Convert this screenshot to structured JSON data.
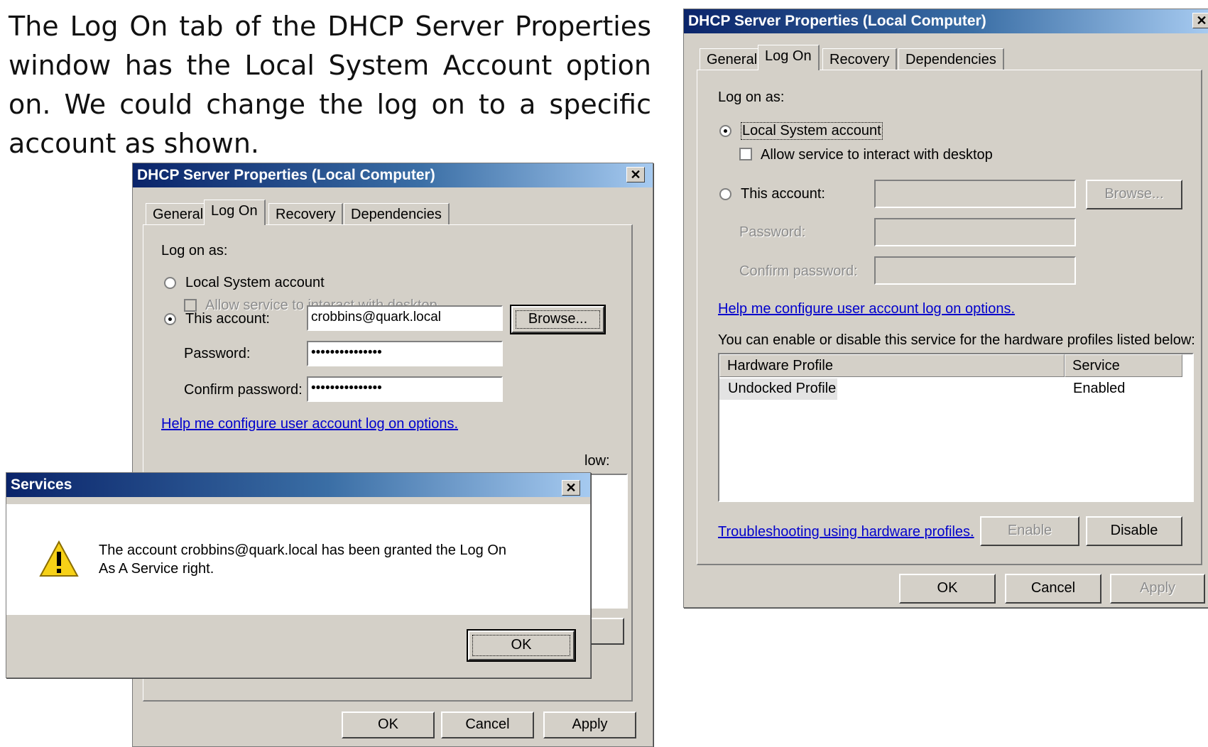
{
  "caption": "The Log On tab of the DHCP Server Properties window has the Local System Account option on. We could change the log on to a specific account as shown.",
  "left_dialog": {
    "title": "DHCP Server Properties (Local Computer)",
    "tabs": [
      "General",
      "Log On",
      "Recovery",
      "Dependencies"
    ],
    "log_on_as": "Log on as:",
    "local_system": "Local System account",
    "allow_interact": "Allow service to interact with desktop",
    "this_account": "This account:",
    "account_value": "crobbins@quark.local",
    "browse": "Browse...",
    "password": "Password:",
    "password_value": "•••••••••••••••",
    "confirm_password": "Confirm password:",
    "confirm_value": "•••••••••••••••",
    "help_link": "Help me configure user account log on options.",
    "partial_text": "low:",
    "ok": "OK",
    "cancel": "Cancel",
    "apply": "Apply"
  },
  "services_dialog": {
    "title": "Services",
    "message_line1": "The account crobbins@quark.local has been granted the Log On",
    "message_line2": "As A Service right.",
    "ok": "OK"
  },
  "right_dialog": {
    "title": "DHCP Server Properties (Local Computer)",
    "tabs": [
      "General",
      "Log On",
      "Recovery",
      "Dependencies"
    ],
    "log_on_as": "Log on as:",
    "local_system": "Local System account",
    "allow_interact": "Allow service to interact with desktop",
    "this_account": "This account:",
    "browse": "Browse...",
    "password": "Password:",
    "confirm_password": "Confirm password:",
    "help_link": "Help me configure user account log on options.",
    "profiles_text": "You can enable or disable this service for the hardware profiles listed below:",
    "col_profile": "Hardware Profile",
    "col_service": "Service",
    "row_profile": "Undocked Profile",
    "row_service": "Enabled",
    "troubleshoot_link": "Troubleshooting using hardware profiles.",
    "enable": "Enable",
    "disable": "Disable",
    "ok": "OK",
    "cancel": "Cancel",
    "apply": "Apply"
  }
}
